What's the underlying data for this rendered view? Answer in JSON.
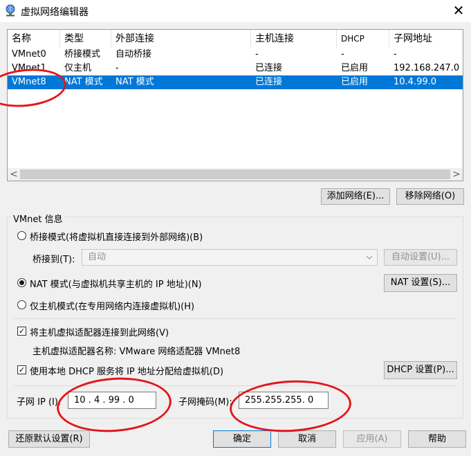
{
  "window": {
    "title": "虚拟网络编辑器",
    "close_glyph": "✕"
  },
  "table": {
    "columns": [
      "名称",
      "类型",
      "外部连接",
      "主机连接",
      "DHCP",
      "子网地址"
    ],
    "rows": [
      [
        "VMnet0",
        "桥接模式",
        "自动桥接",
        "-",
        "-",
        "-"
      ],
      [
        "VMnet1",
        "仅主机",
        "-",
        "已连接",
        "已启用",
        "192.168.247.0"
      ],
      [
        "VMnet8",
        "NAT 模式",
        "NAT 模式",
        "已连接",
        "已启用",
        "10.4.99.0"
      ]
    ],
    "selected_row": 2,
    "scroll_left": "<",
    "scroll_right": ">"
  },
  "buttons": {
    "add_network": "添加网络(E)...",
    "remove_network": "移除网络(O)",
    "auto_settings": "自动设置(U)...",
    "nat_settings": "NAT 设置(S)...",
    "dhcp_settings": "DHCP 设置(P)...",
    "restore_defaults": "还原默认设置(R)",
    "ok": "确定",
    "cancel": "取消",
    "apply": "应用(A)",
    "help": "帮助"
  },
  "vmnet_info": {
    "group_title": "VMnet 信息",
    "bridged_label": "桥接模式(将虚拟机直接连接到外部网络)(B)",
    "bridge_to_label": "桥接到(T):",
    "bridge_to_value": "自动",
    "nat_label": "NAT 模式(与虚拟机共享主机的 IP 地址)(N)",
    "host_only_label": "仅主机模式(在专用网络内连接虚拟机)(H)",
    "selected_mode": "nat",
    "connect_adapter_label": "将主机虚拟适配器连接到此网络(V)",
    "adapter_name_text": "主机虚拟适配器名称: VMware 网络适配器 VMnet8",
    "dhcp_label": "使用本地 DHCP 服务将 IP 地址分配给虚拟机(D)",
    "subnet_ip_label": "子网 IP (I):",
    "subnet_ip_value": "10 . 4 . 99 . 0",
    "subnet_mask_label": "子网掩码(M):",
    "subnet_mask_value": "255.255.255. 0",
    "check_glyph": "✓"
  },
  "colors": {
    "selection": "#0078d7",
    "annotation": "#e3161b"
  }
}
